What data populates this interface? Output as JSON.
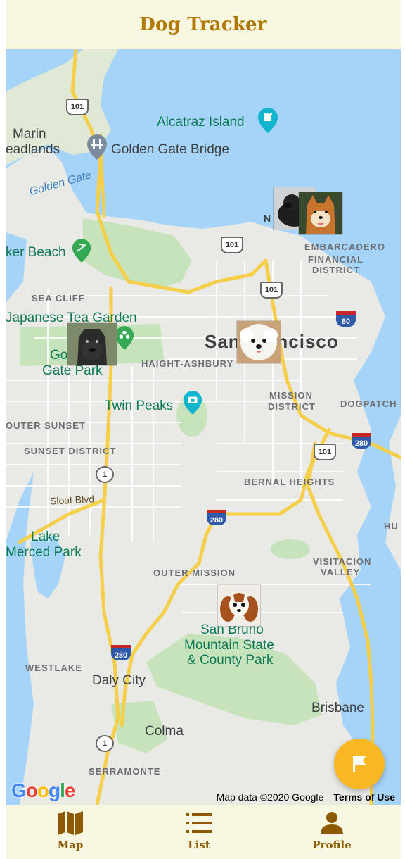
{
  "app": {
    "title": "Dog Tracker"
  },
  "map": {
    "labels": {
      "alcatraz": "Alcatraz Island",
      "marin": "Marin",
      "headlands": "eadlands",
      "golden_gate_bridge": "Golden Gate Bridge",
      "golden_gate_water": "Golden Gate",
      "beach": "ker Beach",
      "embarcadero": "EMBARCADERO",
      "financial": "FINANCIAL",
      "district": "DISTRICT",
      "sea_cliff": "SEA CLIFF",
      "japanese_tea_garden": "Japanese Tea Garden",
      "gg_park_1": "Go",
      "gg_park_2": "Gate Park",
      "haight": "HAIGHT-ASHBURY",
      "san_francisco": "San Francisco",
      "twin_peaks": "Twin Peaks",
      "mission": "MISSION",
      "mission2": "DISTRICT",
      "dogpatch": "DOGPATCH",
      "outer_sunset": "OUTER SUNSET",
      "sunset_district": "SUNSET DISTRICT",
      "bernal": "BERNAL HEIGHTS",
      "sloat": "Sloat Blvd",
      "lake_merced_1": "Lake",
      "lake_merced_2": "Merced Park",
      "outer_mission": "OUTER MISSION",
      "visitacion_1": "VISITACION",
      "visitacion_2": "VALLEY",
      "hu": "HU",
      "san_bruno_1": "San Bruno",
      "san_bruno_2": "Mountain State",
      "san_bruno_3": "& County Park",
      "westlake": "WESTLAKE",
      "daly_city": "Daly City",
      "brisbane": "Brisbane",
      "colma": "Colma",
      "serramonte": "SERRAMONTE",
      "n": "N"
    },
    "shields": {
      "us101_a": "101",
      "us101_b": "101",
      "us101_c": "101",
      "us101_d": "101",
      "i80": "80",
      "i280_a": "280",
      "i280_b": "280",
      "i280_c": "280",
      "ca1_a": "1",
      "ca1_b": "1"
    },
    "attribution": "Map data ©2020 Google",
    "terms": "Terms of Use",
    "google_logo": "Google"
  },
  "markers": [
    {
      "name": "black-labrador",
      "icon": "dog-photo-black-lab"
    },
    {
      "name": "shiba-inu",
      "icon": "dog-photo-shiba"
    },
    {
      "name": "cane-corso",
      "icon": "dog-photo-cane-corso"
    },
    {
      "name": "bichon-frise",
      "icon": "dog-photo-bichon"
    },
    {
      "name": "cavalier-king-charles",
      "icon": "dog-photo-cavalier"
    }
  ],
  "fab": {
    "icon": "flag-icon"
  },
  "tabs": [
    {
      "label": "Map",
      "icon": "map-icon"
    },
    {
      "label": "List",
      "icon": "list-icon"
    },
    {
      "label": "Profile",
      "icon": "person-icon"
    }
  ],
  "colors": {
    "header_bg": "#f8f7e1",
    "title": "#b27900",
    "tab_text": "#8c5a00",
    "fab": "#f9b823",
    "water": "#a6d4f8",
    "land": "#e9e9e6",
    "park": "#c6e3bb",
    "freeway": "#f6cf4a"
  }
}
